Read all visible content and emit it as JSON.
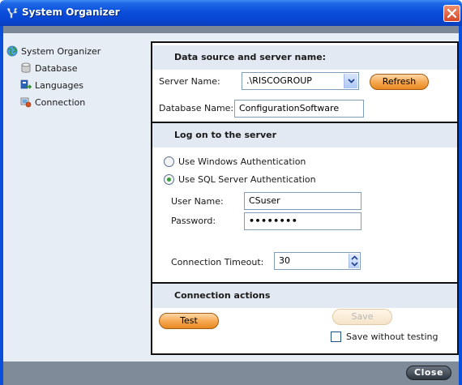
{
  "window": {
    "title": "System Organizer",
    "icon": "organizer-app-icon",
    "close_icon": "close-icon"
  },
  "sidebar": {
    "items": [
      {
        "label": "System Organizer",
        "icon": "globe-icon"
      },
      {
        "label": "Database",
        "icon": "database-icon"
      },
      {
        "label": "Languages",
        "icon": "languages-icon"
      },
      {
        "label": "Connection",
        "icon": "connection-icon",
        "selected": true
      }
    ]
  },
  "data_source": {
    "heading": "Data source and server name:",
    "server_label": "Server Name:",
    "server_value": ".\\RISCOGROUP",
    "refresh_label": "Refresh",
    "database_label": "Database Name:",
    "database_value": "ConfigurationSoftware"
  },
  "logon": {
    "heading": "Log on to the server",
    "windows_auth_label": "Use Windows Authentication",
    "sql_auth_label": "Use SQL Server Authentication",
    "selected_auth": "sql",
    "user_label": "User Name:",
    "user_value": "CSuser",
    "password_label": "Password:",
    "password_value": "••••••••",
    "timeout_label": "Connection Timeout:",
    "timeout_value": "30"
  },
  "actions": {
    "heading": "Connection actions",
    "test_label": "Test",
    "save_label": "Save",
    "save_without_testing_label": "Save without testing",
    "save_without_testing_checked": false
  },
  "footer": {
    "close_label": "Close"
  },
  "colors": {
    "titlebar": "#0a4fdb",
    "accent_button": "#f5a64f",
    "sidebar_bg": "#e7edf5",
    "section_head_bg": "#e3e9f2"
  }
}
